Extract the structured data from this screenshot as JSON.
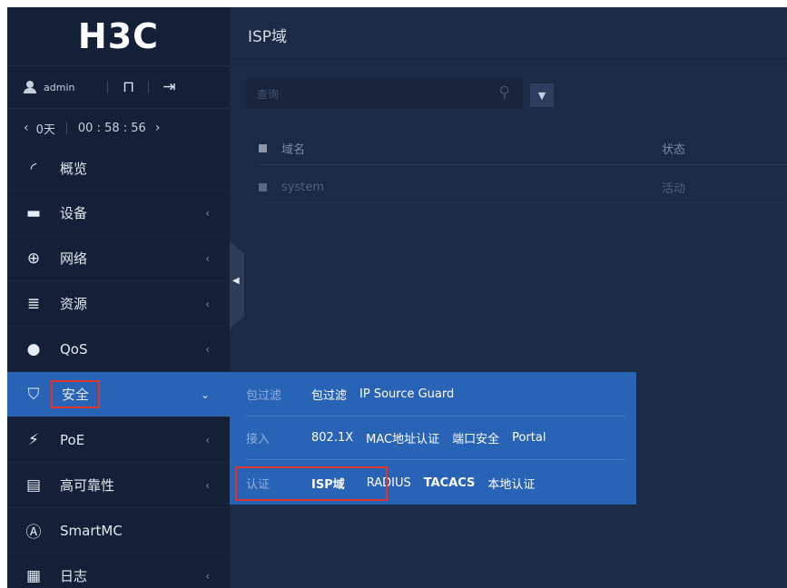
{
  "brand": "H3C",
  "user": {
    "name": "admin",
    "save_icon": "save-icon",
    "logout_icon": "logout-icon"
  },
  "session": {
    "days": "0天",
    "time": "00 : 58 : 56"
  },
  "nav": [
    {
      "label": "概览",
      "icon": "dashboard-icon",
      "chevron": ""
    },
    {
      "label": "设备",
      "icon": "device-icon",
      "chevron": "‹"
    },
    {
      "label": "网络",
      "icon": "globe-icon",
      "chevron": "‹"
    },
    {
      "label": "资源",
      "icon": "database-icon",
      "chevron": "‹"
    },
    {
      "label": "QoS",
      "icon": "qos-icon",
      "chevron": "‹"
    },
    {
      "label": "安全",
      "icon": "shield-icon",
      "chevron": "⌄"
    },
    {
      "label": "PoE",
      "icon": "poe-icon",
      "chevron": "‹"
    },
    {
      "label": "高可靠性",
      "icon": "reliability-icon",
      "chevron": "‹"
    },
    {
      "label": "SmartMC",
      "icon": "smartmc-icon",
      "chevron": ""
    },
    {
      "label": "日志",
      "icon": "log-icon",
      "chevron": "‹"
    }
  ],
  "main": {
    "title": "ISP域",
    "search_placeholder": "查询",
    "table": {
      "headers": [
        "域名",
        "状态"
      ],
      "rows": [
        [
          "system",
          "活动"
        ]
      ]
    }
  },
  "flyout": {
    "groups": [
      {
        "label": "包过滤",
        "items": [
          "包过滤",
          "IP Source Guard"
        ]
      },
      {
        "label": "接入",
        "items": [
          "802.1X",
          "MAC地址认证",
          "端口安全",
          "Portal"
        ]
      },
      {
        "label": "认证",
        "items": [
          "ISP域",
          "RADIUS",
          "TACACS",
          "本地认证"
        ]
      }
    ]
  },
  "colors": {
    "sidebar": "#132038",
    "main": "#1b2a45",
    "accent": "#2963b6",
    "highlight": "#e0342d"
  }
}
